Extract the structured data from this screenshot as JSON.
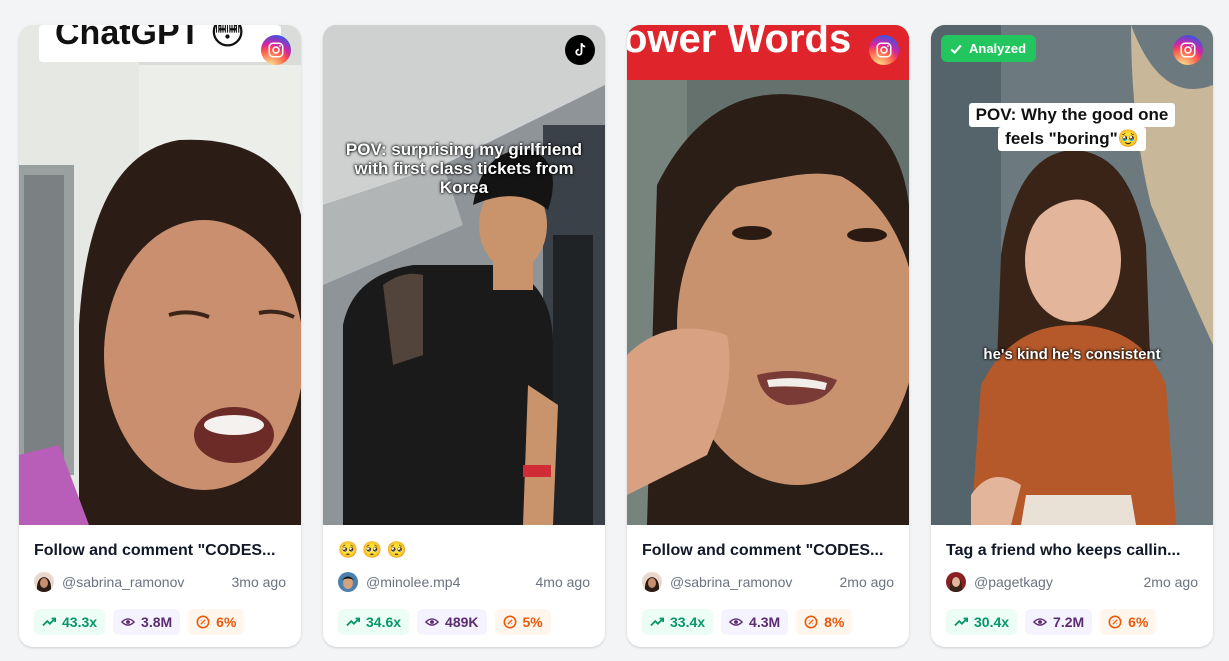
{
  "cards": [
    {
      "platform": "instagram",
      "platform_icon": "instagram-icon",
      "overlay_title": "ChatGPT 😳",
      "caption": "",
      "title": "Follow and comment \"CODES...",
      "handle": "@sabrina_ramonov",
      "age": "3mo ago",
      "growth": "43.3x",
      "views": "3.8M",
      "engagement": "6%"
    },
    {
      "platform": "tiktok",
      "platform_icon": "tiktok-icon",
      "caption": "POV: surprising my girlfriend with first class tickets from Korea",
      "title": "🥺 🥺 🥺",
      "handle": "@minolee.mp4",
      "age": "4mo ago",
      "growth": "34.6x",
      "views": "489K",
      "engagement": "5%"
    },
    {
      "platform": "instagram",
      "platform_icon": "instagram-icon",
      "overlay_title": "ower Words",
      "caption": "",
      "title": "Follow and comment \"CODES...",
      "handle": "@sabrina_ramonov",
      "age": "2mo ago",
      "growth": "33.4x",
      "views": "4.3M",
      "engagement": "8%"
    },
    {
      "platform": "instagram",
      "platform_icon": "instagram-icon",
      "badge": "Analyzed",
      "caption_box": [
        "POV: Why the good one",
        "feels \"boring\"🥹"
      ],
      "caption_mid": "he's kind he's consistent",
      "title": "Tag a friend who keeps callin...",
      "handle": "@pagetkagy",
      "age": "2mo ago",
      "growth": "30.4x",
      "views": "7.2M",
      "engagement": "6%"
    }
  ],
  "colors": {
    "growth": "#059669",
    "views": "#5b2c6f",
    "engagement": "#ea580c",
    "analyzed": "#22c55e"
  }
}
